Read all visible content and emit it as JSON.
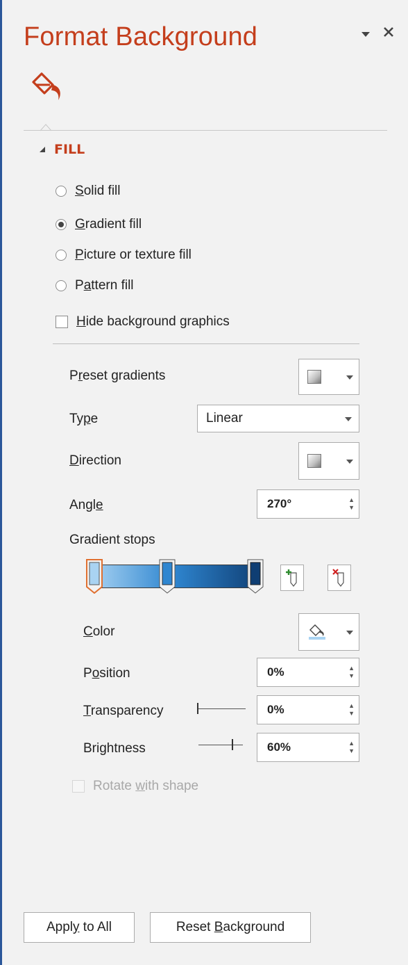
{
  "pane": {
    "title": "Format Background",
    "options_icon": "pane-options-caret-icon",
    "close_icon": "close-icon",
    "tab_icon": "fill-line-paint-bucket-icon"
  },
  "fill_section": {
    "heading": "FILL",
    "options": [
      {
        "pre": "",
        "key": "S",
        "post": "olid fill",
        "selected": false
      },
      {
        "pre": "",
        "key": "G",
        "post": "radient fill",
        "selected": true
      },
      {
        "pre": "",
        "key": "P",
        "post": "icture or texture fill",
        "selected": false
      },
      {
        "pre": "P",
        "key": "a",
        "post": "ttern fill",
        "selected": false
      }
    ],
    "hide_graphics": {
      "pre": "",
      "key": "H",
      "post": "ide background graphics",
      "checked": false
    }
  },
  "gradient": {
    "preset": {
      "pre": "P",
      "key": "r",
      "post": "eset gradients"
    },
    "type": {
      "pre": "Ty",
      "key": "p",
      "post": "e",
      "value": "Linear"
    },
    "direction": {
      "pre": "",
      "key": "D",
      "post": "irection"
    },
    "angle": {
      "pre": "Angl",
      "key": "e",
      "post": "",
      "value": "270°"
    },
    "stops_label": "Gradient stops",
    "stops": [
      {
        "position_pct": 0,
        "color": "#a9d3f2",
        "selected": true
      },
      {
        "position_pct": 48,
        "color": "#2f86d0",
        "selected": false
      },
      {
        "position_pct": 100,
        "color": "#0f3e73",
        "selected": false
      }
    ],
    "add_stop_icon": "add-gradient-stop-icon",
    "remove_stop_icon": "remove-gradient-stop-icon",
    "color": {
      "pre": "",
      "key": "C",
      "post": "olor",
      "icon": "paint-bucket-icon"
    },
    "position": {
      "pre": "P",
      "key": "o",
      "post": "sition",
      "value": "0%"
    },
    "transparency": {
      "pre": "",
      "key": "T",
      "post": "ransparency",
      "value": "0%",
      "level": 0
    },
    "brightness": {
      "pre": "Brightness",
      "key": "",
      "post": "",
      "value": "60%",
      "level": 0.6
    },
    "rotate": {
      "pre": "Rotate ",
      "key": "w",
      "post": "ith shape",
      "disabled": true
    }
  },
  "footer": {
    "apply_all": {
      "pre": "Appl",
      "key": "y",
      "post": " to All"
    },
    "reset": {
      "pre": "Reset ",
      "key": "B",
      "post": "ackground"
    }
  },
  "colors": {
    "accent": "#c43e1c",
    "frame": "#2b579a",
    "panel_bg": "#f2f2f2"
  }
}
